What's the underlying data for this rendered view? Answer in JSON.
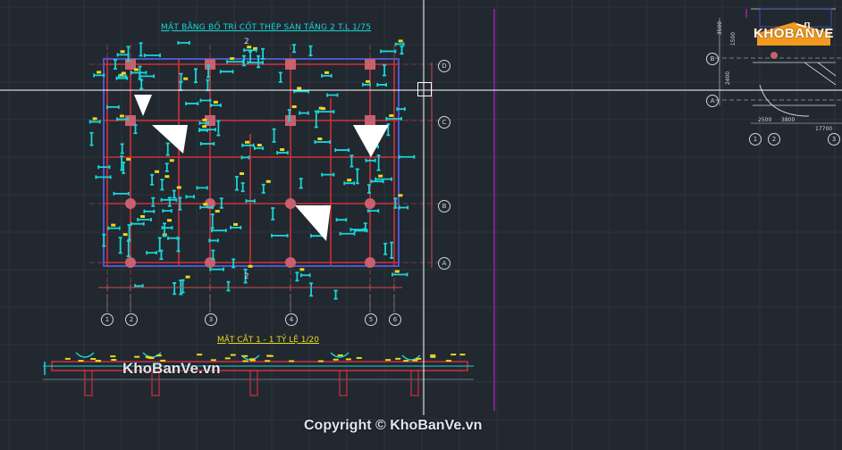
{
  "drawing": {
    "plan_title": "MẶT BẰNG BỐ TRÍ CỐT THÉP SÀN TẦNG 2 T.L 1/75",
    "section_title": "MẶT CẮT 1 - 1 TỶ LỆ 1/20",
    "section_marks": [
      "2",
      "2"
    ],
    "plan_axes_bottom": [
      "1",
      "2",
      "3",
      "4",
      "5",
      "6"
    ],
    "plan_axes_right": [
      "D",
      "C",
      "B",
      "A"
    ],
    "inset_axes_left": [
      "B",
      "A"
    ],
    "inset_axes_bottom": [
      "1",
      "2",
      "3"
    ],
    "inset_dims_bottom": [
      "2500",
      "3800",
      "17700"
    ],
    "inset_dims_left": [
      "3500",
      "1500",
      "2400"
    ]
  },
  "watermarks": {
    "site": "KhoBanVe.vn",
    "copyright": "Copyright © KhoBanVe.vn"
  },
  "logo": {
    "text": "KHOBANVE"
  },
  "colors": {
    "background": "#212830",
    "rebar_cyan": "#18d6d6",
    "beam_red": "#d0303a",
    "slab_blue": "#4a58c8",
    "column_pink": "#c8606e",
    "label_yellow": "#e8d820",
    "crosshair": "#ffffff",
    "magenta_frame": "#a020b0",
    "logo_orange": "#f29a1f"
  }
}
